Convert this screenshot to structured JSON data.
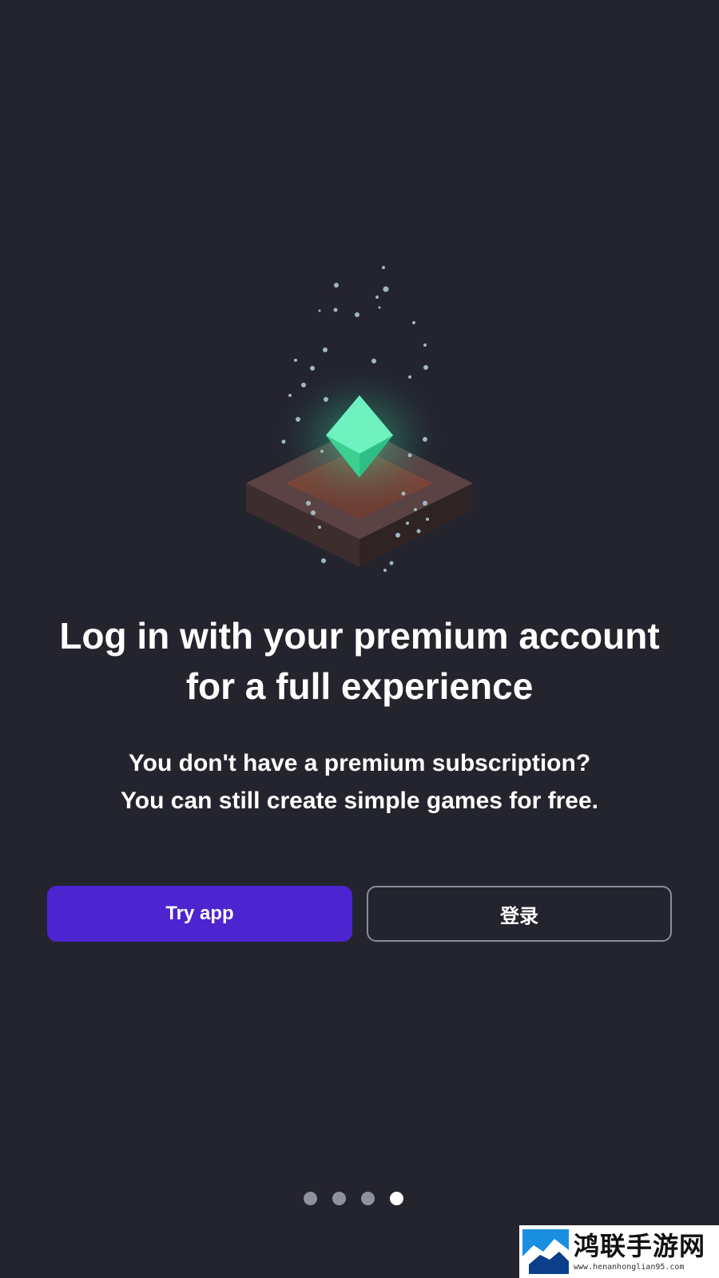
{
  "colors": {
    "background": "#24242e",
    "primary_button": "#4c24d0",
    "outline_border": "#8a8d99",
    "dot_inactive": "#8e929e",
    "dot_active": "#ffffff",
    "gem": "#4fe3a8"
  },
  "hero": {
    "illustration": "gem-on-pedestal-illustration"
  },
  "onboarding": {
    "title_line1": "Log in with your premium account",
    "title_line2": "for a full experience",
    "subtitle_line1": "You don't have a premium subscription?",
    "subtitle_line2": "You can still create simple games for free."
  },
  "actions": {
    "try_app_label": "Try app",
    "login_label": "登录"
  },
  "pagination": {
    "total": 4,
    "current": 4
  },
  "watermark": {
    "name": "鸿联手游网",
    "url": "www.henanhonglian95.com"
  }
}
